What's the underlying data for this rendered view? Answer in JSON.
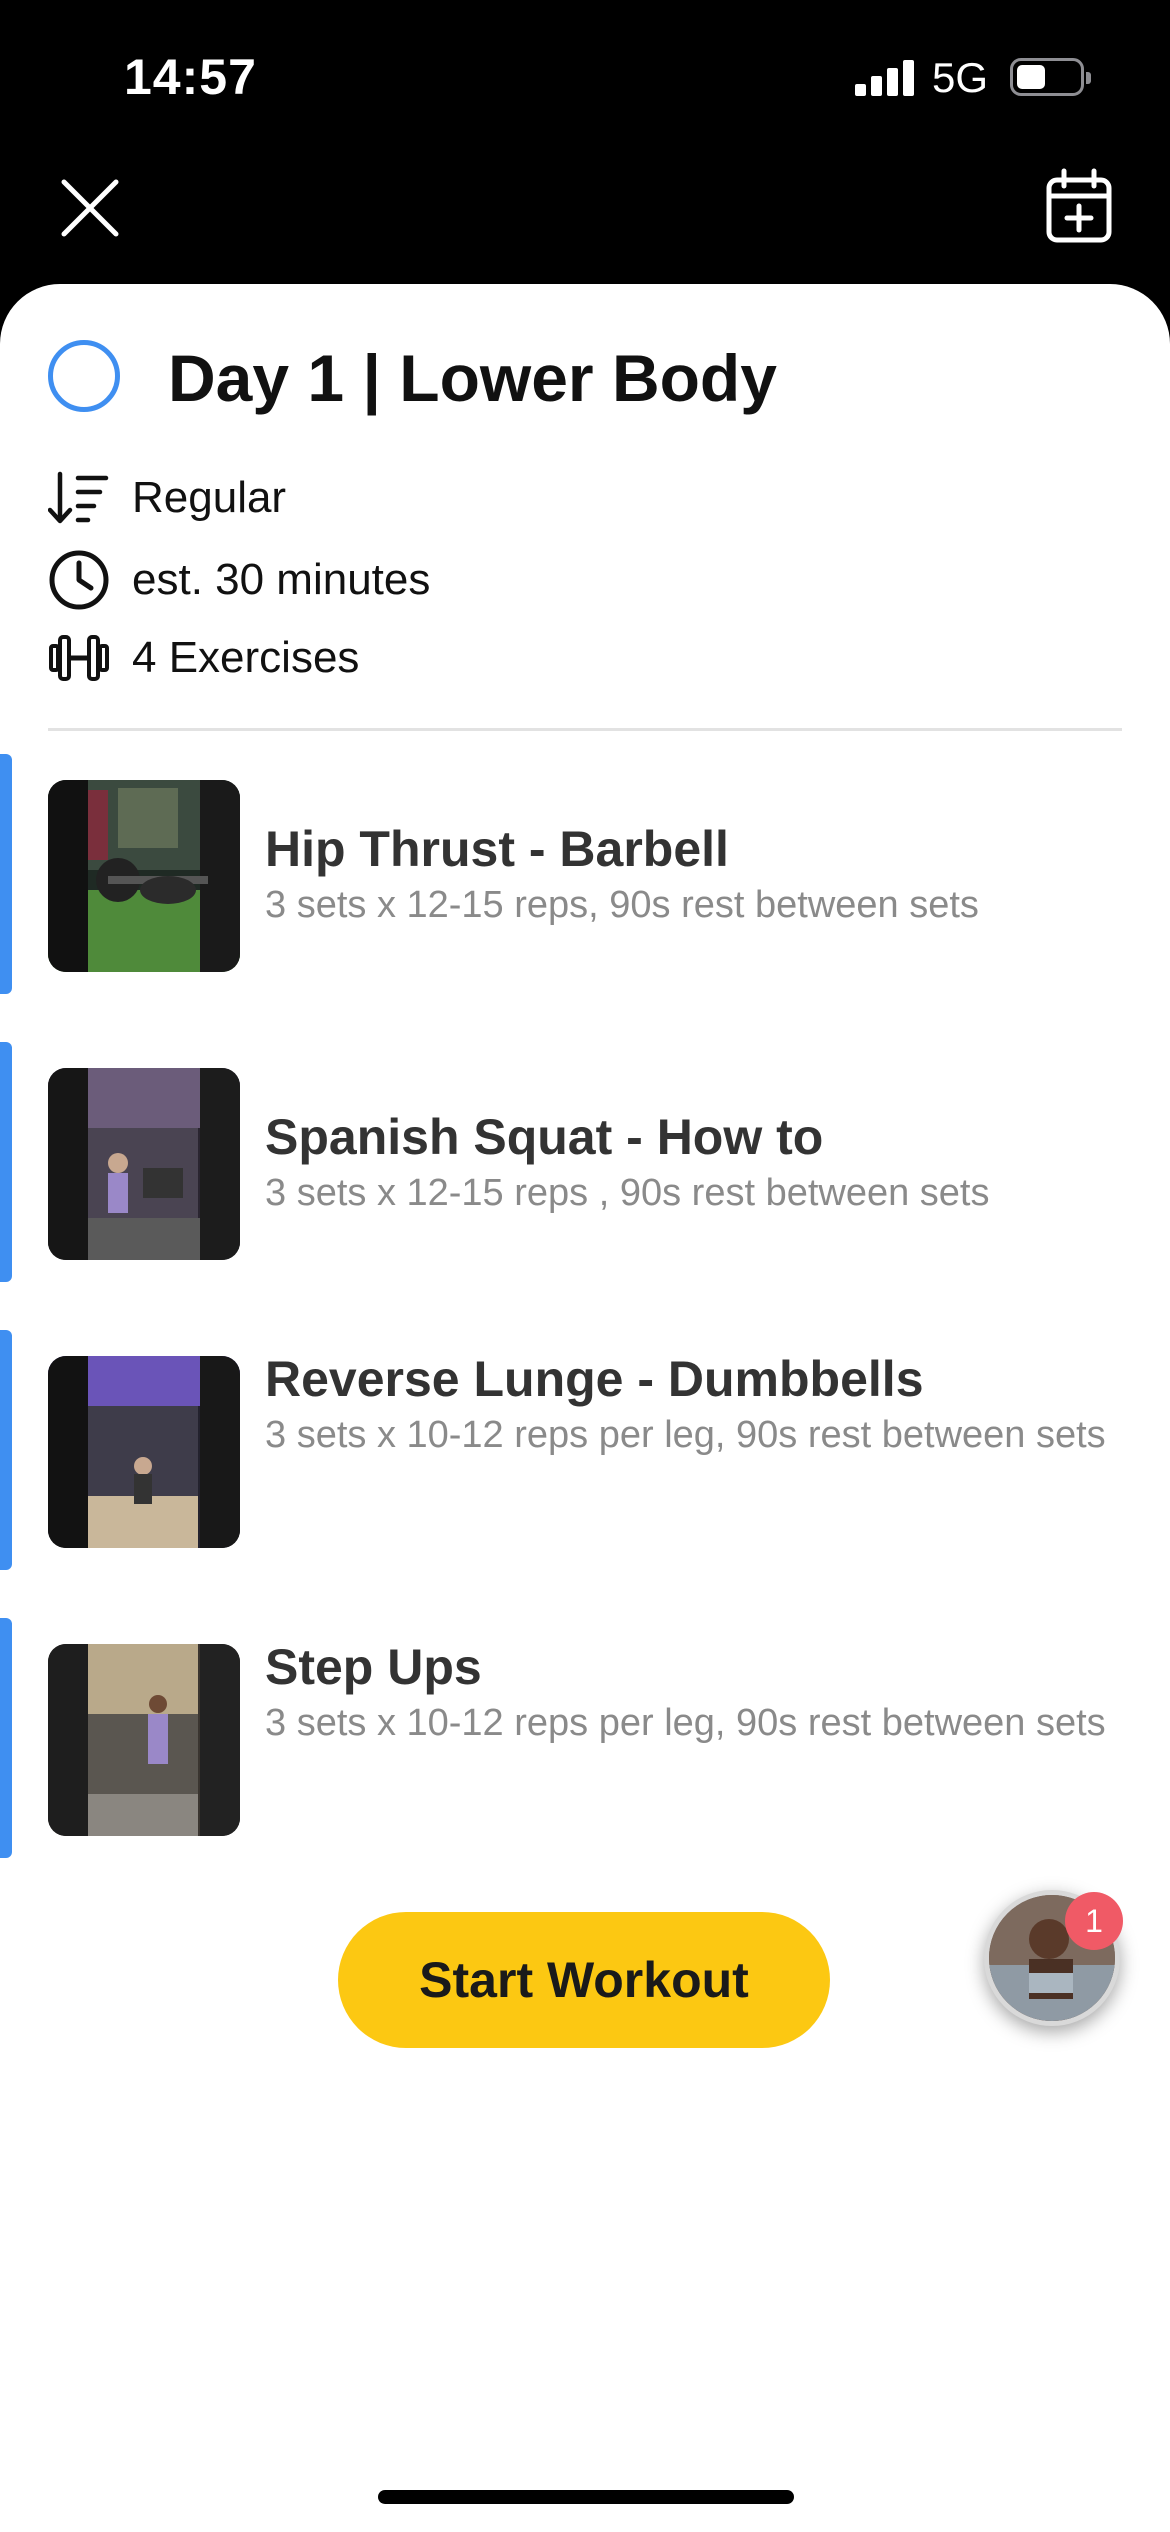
{
  "status_bar": {
    "time": "14:57",
    "network": "5G",
    "battery_level": 0.45
  },
  "nav": {
    "close_icon": "close-icon",
    "calendar_icon": "calendar-add-icon"
  },
  "workout": {
    "title": "Day 1 | Lower Body",
    "meta": [
      {
        "icon": "sort-down-icon",
        "label": "Regular"
      },
      {
        "icon": "clock-icon",
        "label": "est. 30 minutes"
      },
      {
        "icon": "dumbbell-icon",
        "label": "4 Exercises"
      }
    ]
  },
  "exercises": [
    {
      "name": "Hip Thrust - Barbell",
      "detail": "3 sets x 12-15 reps, 90s rest between sets"
    },
    {
      "name": "Spanish Squat - How to",
      "detail": "3 sets x 12-15 reps , 90s rest between sets"
    },
    {
      "name": "Reverse Lunge - Dumbbells",
      "detail": "3 sets x 10-12 reps per leg, 90s rest between sets"
    },
    {
      "name": "Step Ups",
      "detail": "3 sets x 10-12 reps per leg, 90s rest between sets"
    }
  ],
  "start_button": {
    "label": "Start Workout"
  },
  "coach": {
    "badge_count": "1"
  },
  "colors": {
    "accent": "#3f8ff1",
    "primary_button": "#fcc812",
    "badge": "#f05a66"
  }
}
